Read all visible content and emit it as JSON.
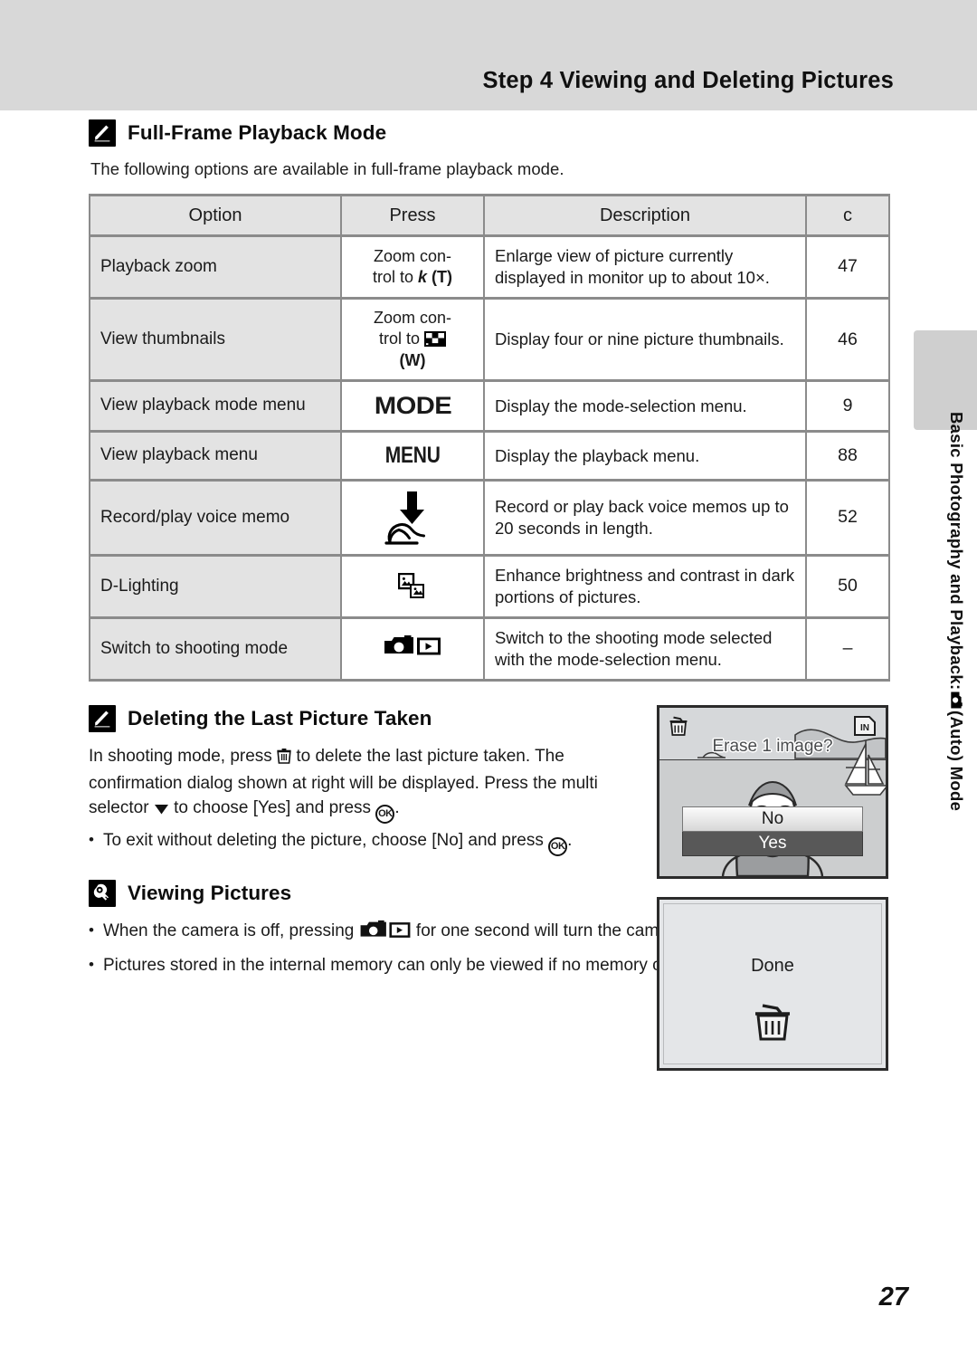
{
  "header": {
    "title": "Step 4 Viewing and Deleting Pictures"
  },
  "side_tab": {
    "label_before_icon": "Basic Photography and Playback:",
    "icon": "camera-icon",
    "label_after_icon": "(Auto) Mode"
  },
  "sections": {
    "full_frame": {
      "icon": "pencil-note-icon",
      "heading": "Full-Frame Playback Mode",
      "intro": "The following options are available in full-frame playback mode.",
      "table": {
        "columns": [
          "Option",
          "Press",
          "Description",
          "c"
        ],
        "rows": [
          {
            "option": "Playback zoom",
            "press_text_1": "Zoom con-",
            "press_text_2": "trol to",
            "press_glyph": "k",
            "press_text_3": "(T)",
            "press_icon": "zoom-in-glyph",
            "description": "Enlarge view of picture currently displayed in monitor up to about 10×.",
            "page": "47"
          },
          {
            "option": "View thumbnails",
            "press_text_1": "Zoom con-",
            "press_text_2": "trol to",
            "press_glyph": "",
            "press_text_3": "(W)",
            "press_icon": "thumbnail-grid-icon",
            "description": "Display four or nine picture thumbnails.",
            "page": "46"
          },
          {
            "option": "View playback mode menu",
            "press_text_1": "",
            "press_text_2": "",
            "press_glyph": "MODE",
            "press_text_3": "",
            "press_icon": "mode-button-icon",
            "description": "Display the mode-selection menu.",
            "page": "9"
          },
          {
            "option": "View playback menu",
            "press_text_1": "",
            "press_text_2": "",
            "press_glyph": "MENU",
            "press_text_3": "",
            "press_icon": "menu-button-icon",
            "description": "Display the playback menu.",
            "page": "88"
          },
          {
            "option": "Record/play voice memo",
            "press_text_1": "",
            "press_text_2": "",
            "press_glyph": "",
            "press_text_3": "",
            "press_icon": "press-shutter-finger-icon",
            "description": "Record or play back voice memos up to 20 seconds in length.",
            "page": "52"
          },
          {
            "option": "D-Lighting",
            "press_text_1": "",
            "press_text_2": "",
            "press_glyph": "",
            "press_text_3": "",
            "press_icon": "d-lighting-icon",
            "description": "Enhance brightness and contrast in dark portions of pictures.",
            "page": "50"
          },
          {
            "option": "Switch to shooting mode",
            "press_text_1": "",
            "press_text_2": "",
            "press_glyph": "",
            "press_text_3": "",
            "press_icon": "camera-playback-toggle-icon",
            "description": "Switch to the shooting mode selected with the mode-selection menu.",
            "page": "–"
          }
        ]
      }
    },
    "deleting": {
      "icon": "pencil-note-icon",
      "heading": "Deleting the Last Picture Taken",
      "paragraph_part_1": "In shooting mode, press",
      "paragraph_part_2": "to delete the last picture taken. The confirmation dialog shown at right will be displayed. Press the multi selector",
      "paragraph_part_3": "to choose [Yes] and press",
      "paragraph_part_4": ".",
      "bullet_dot": "•",
      "bullet_part_1": "To exit without deleting the picture, choose [No] and press",
      "bullet_part_2": ".",
      "ok_label": "OK"
    },
    "viewing": {
      "icon": "tip-lightbulb-icon",
      "heading": "Viewing Pictures",
      "bullets": [
        {
          "dot": "•",
          "part_1": "When the camera is off, pressing",
          "icon": "camera-playback-toggle-icon",
          "part_2": "for one second will turn the camera on in playback mode."
        },
        {
          "dot": "•",
          "part_1": "Pictures stored in the internal memory can only be viewed if no memory card is inserted.",
          "icon": "",
          "part_2": ""
        }
      ]
    }
  },
  "lcd_screens": [
    {
      "name": "erase-confirm-dialog",
      "trash_icon": "trash-can-icon",
      "memory_badge": "IN",
      "prompt": "Erase 1 image?",
      "options": [
        {
          "label": "No",
          "selected": false
        },
        {
          "label": "Yes",
          "selected": true
        }
      ]
    },
    {
      "name": "done-screen",
      "message": "Done",
      "icon": "trash-can-icon"
    }
  ],
  "page_number": "27",
  "colors": {
    "header_band": "#d8d8d8",
    "table_header_bg": "#e3e3e3",
    "table_option_bg": "#e3e3e3",
    "table_border": "#8b8b8b",
    "side_tab": "#cfcfcf",
    "lcd_sky": "#d4d6d8",
    "lcd_selected_row": "#585858"
  }
}
